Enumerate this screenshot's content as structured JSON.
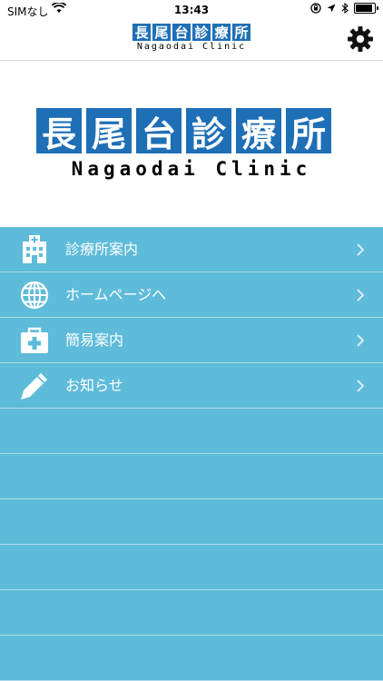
{
  "status_bar": {
    "carrier": "SIMなし",
    "time": "13:43"
  },
  "header": {
    "logo_kanji": [
      "長",
      "尾",
      "台",
      "診",
      "療",
      "所"
    ],
    "logo_sub": "Nagaodai Clinic",
    "settings_icon": "gear-icon"
  },
  "hero": {
    "logo_kanji": [
      "長",
      "尾",
      "台",
      "診",
      "療",
      "所"
    ],
    "logo_sub": "Nagaodai Clinic"
  },
  "menu": {
    "background": "#5ebbd9",
    "items": [
      {
        "label": "診療所案内",
        "icon": "hospital-icon"
      },
      {
        "label": "ホームページへ",
        "icon": "globe-icon"
      },
      {
        "label": "簡易案内",
        "icon": "first-aid-kit-icon"
      },
      {
        "label": "お知らせ",
        "icon": "pencil-icon"
      }
    ],
    "empty_rows": 6
  }
}
